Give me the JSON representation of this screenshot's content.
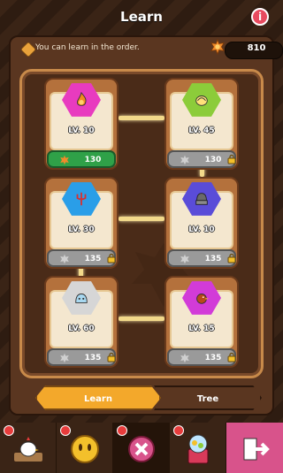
{
  "header": {
    "title": "Learn",
    "info_label": "i"
  },
  "order": {
    "text": "You can learn in the order.",
    "currency": "810"
  },
  "skills": [
    {
      "level": "LV. 10",
      "cost": "130",
      "state": "active",
      "badge_color": "#e83bbf",
      "icon": "flame-icon"
    },
    {
      "level": "LV. 45",
      "cost": "130",
      "state": "locked",
      "badge_color": "#8ccc3a",
      "icon": "shell-icon"
    },
    {
      "level": "LV. 30",
      "cost": "135",
      "state": "locked",
      "badge_color": "#2a9ee8",
      "icon": "trident-icon"
    },
    {
      "level": "LV. 10",
      "cost": "135",
      "state": "locked",
      "badge_color": "#5a4cd8",
      "icon": "helmet-icon"
    },
    {
      "level": "LV. 60",
      "cost": "135",
      "state": "locked",
      "badge_color": "#d6d6d6",
      "icon": "slime-icon"
    },
    {
      "level": "LV. 15",
      "cost": "135",
      "state": "locked",
      "badge_color": "#d23bd8",
      "icon": "bird-icon"
    }
  ],
  "tabs": [
    {
      "label": "Learn",
      "active": true
    },
    {
      "label": "Tree",
      "active": false
    }
  ],
  "nav": [
    {
      "icon": "chicken-icon"
    },
    {
      "icon": "coin-face-icon"
    },
    {
      "icon": "close-icon"
    },
    {
      "icon": "gacha-machine-icon"
    },
    {
      "icon": "exit-icon"
    }
  ],
  "colors": {
    "accent": "#f3a82b",
    "active_button": "#2fa148",
    "exit": "#d8538b"
  }
}
